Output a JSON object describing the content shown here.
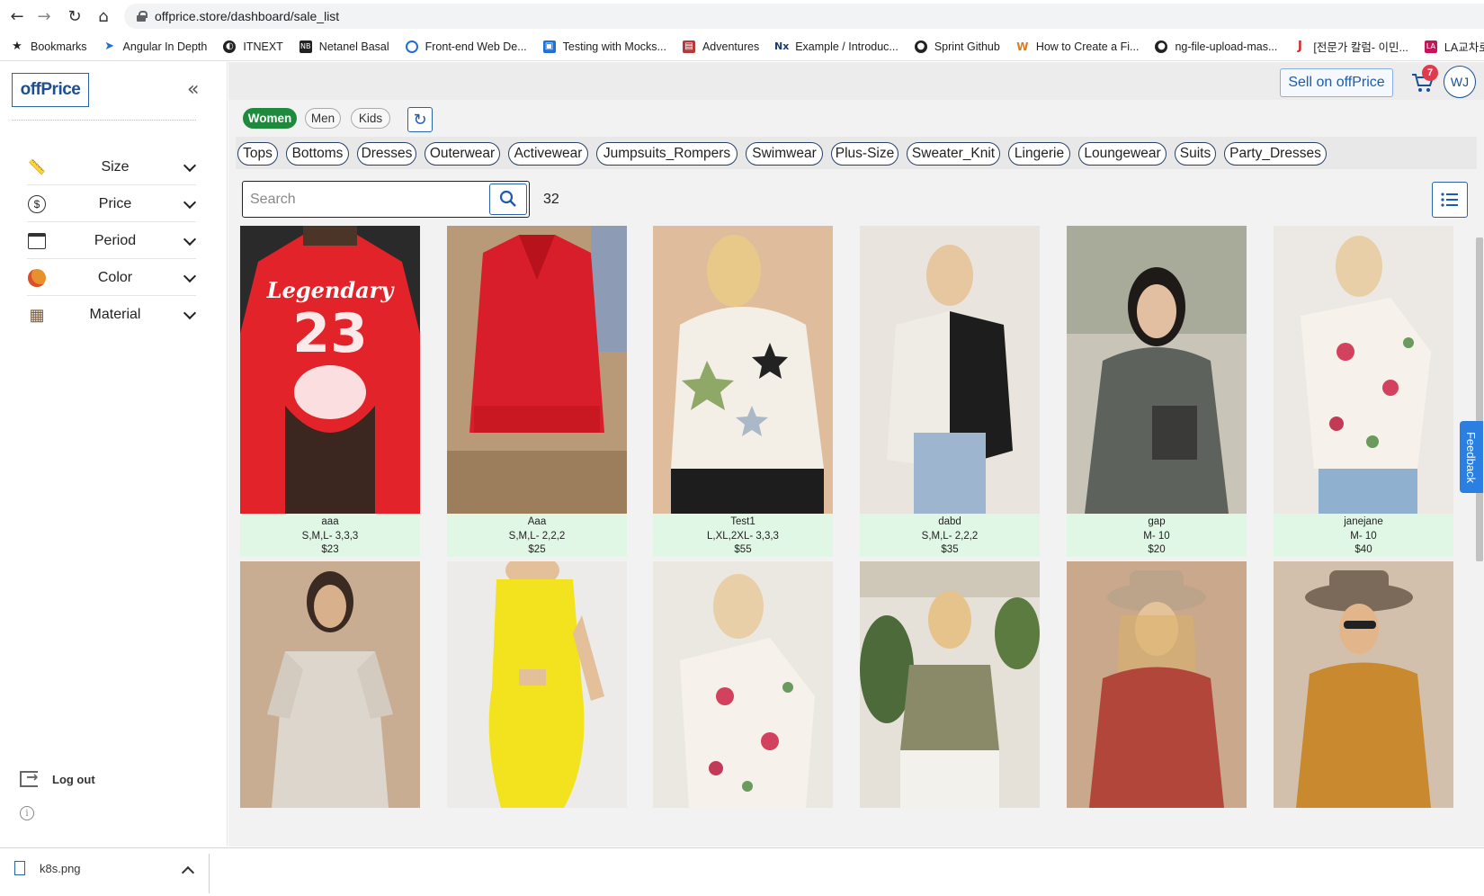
{
  "browser": {
    "url": "offprice.store/dashboard/sale_list",
    "bookmarks": [
      {
        "label": "Bookmarks",
        "icon": "star-icon",
        "color": "#222222"
      },
      {
        "label": "Angular In Depth",
        "icon": "angular-icon",
        "color": "#1e6fd9"
      },
      {
        "label": "ITNEXT",
        "icon": "itnext-icon",
        "color": "#222222"
      },
      {
        "label": "Netanel Basal",
        "icon": "nb-icon",
        "color": "#222222"
      },
      {
        "label": "Front-end Web De...",
        "icon": "frontend-icon",
        "color": "#1e6fd9"
      },
      {
        "label": "Testing with Mocks...",
        "icon": "testing-icon",
        "color": "#1e6fd9"
      },
      {
        "label": "Adventures",
        "icon": "adventures-icon",
        "color": "#b33a3a"
      },
      {
        "label": "Example / Introduc...",
        "icon": "nx-icon",
        "color": "#1c3d6e"
      },
      {
        "label": "Sprint Github",
        "icon": "github-icon",
        "color": "#222222"
      },
      {
        "label": "How to Create a Fi...",
        "icon": "w-icon",
        "color": "#e07a1f"
      },
      {
        "label": "ng-file-upload-mas...",
        "icon": "github-icon",
        "color": "#222222"
      },
      {
        "label": "[전문가 칼럼- 이민...",
        "icon": "j-icon",
        "color": "#d9231e"
      },
      {
        "label": "LA교차로",
        "icon": "la-icon",
        "color": "#c2185b"
      }
    ]
  },
  "sidebar": {
    "logo": "offPrice",
    "filters": [
      {
        "label": "Size",
        "icon": "ruler-icon"
      },
      {
        "label": "Price",
        "icon": "dollar-icon"
      },
      {
        "label": "Period",
        "icon": "calendar-icon"
      },
      {
        "label": "Color",
        "icon": "palette-icon"
      },
      {
        "label": "Material",
        "icon": "fabric-icon"
      }
    ],
    "logout_label": "Log out"
  },
  "header": {
    "sell_label": "Sell on offPrice",
    "cart_count": "7",
    "avatar_initials": "WJ"
  },
  "genders": [
    {
      "label": "Women",
      "active": true
    },
    {
      "label": "Men",
      "active": false
    },
    {
      "label": "Kids",
      "active": false
    }
  ],
  "categories": [
    "Tops",
    "Bottoms",
    "Dresses",
    "Outerwear",
    "Activewear",
    "Jumpsuits_Rompers",
    "Swimwear",
    "Plus-Size",
    "Sweater_Knit",
    "Lingerie",
    "Loungewear",
    "Suits",
    "Party_Dresses"
  ],
  "search": {
    "placeholder": "Search",
    "count": "32"
  },
  "feedback_label": "Feedback",
  "products": [
    {
      "name": "aaa",
      "sizes": "S,M,L- 3,3,3",
      "price": "$23"
    },
    {
      "name": "Aaa",
      "sizes": "S,M,L- 2,2,2",
      "price": "$25"
    },
    {
      "name": "Test1",
      "sizes": "L,XL,2XL- 3,3,3",
      "price": "$55"
    },
    {
      "name": "dabd",
      "sizes": "S,M,L- 2,2,2",
      "price": "$35"
    },
    {
      "name": "gap",
      "sizes": "M- 10",
      "price": "$20"
    },
    {
      "name": "janejane",
      "sizes": "M- 10",
      "price": "$40"
    }
  ],
  "downloads": {
    "file": "k8s.png"
  },
  "colors": {
    "accent": "#1c4f92",
    "active_chip": "#1f8a3d",
    "card_meta_bg": "#e0f7e6",
    "badge": "#e03a4e"
  }
}
